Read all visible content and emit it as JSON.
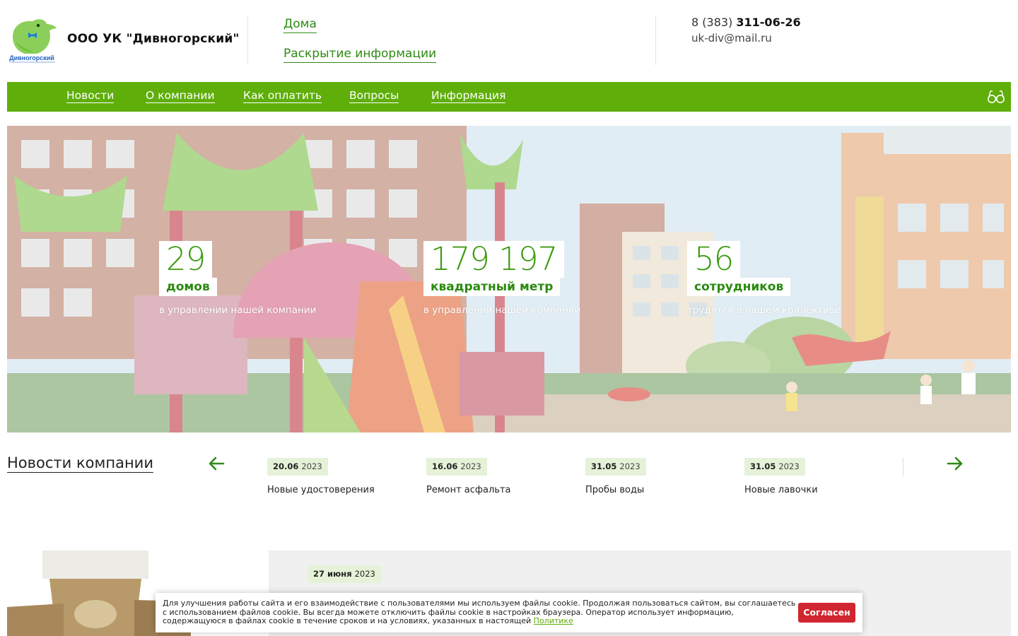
{
  "header": {
    "company_name": "ООО УК \"Дивногорский\"",
    "logo_text": "Дивногорский",
    "links": [
      "Дома",
      "Раскрытие информации"
    ],
    "phone_prefix": "8 (383)",
    "phone_number": "311-06-26",
    "email": "uk-div@mail.ru"
  },
  "nav": {
    "items": [
      "Новости",
      "О компании",
      "Как оплатить",
      "Вопросы",
      "Информация"
    ],
    "accessibility_icon": "glasses-icon"
  },
  "stats": [
    {
      "value": "29",
      "unit": "домов",
      "desc": "в управлении нашей компании"
    },
    {
      "value": "179 197",
      "unit": "квадратный метр",
      "desc": "в управлении нашей компании"
    },
    {
      "value": "56",
      "unit": "сотрудников",
      "desc": "трудятся в нашем коллективе"
    }
  ],
  "news": {
    "title": "Новости компании",
    "items": [
      {
        "day": "20.06",
        "year": "2023",
        "title": "Новые удостоверения"
      },
      {
        "day": "16.06",
        "year": "2023",
        "title": "Ремонт асфальта"
      },
      {
        "day": "31.05",
        "year": "2023",
        "title": "Пробы воды"
      },
      {
        "day": "31.05",
        "year": "2023",
        "title": "Новые лавочки"
      }
    ]
  },
  "article": {
    "day": "27 июня",
    "year": "2023"
  },
  "cookie": {
    "text": "Для улучшения работы сайта и его взаимодействие с пользователями мы используем файлы cookie. Продолжая пользоваться сайтом, вы соглашаетесь с использованием файлов cookie. Вы всегда можете отключить файлы cookie в настройках браузера. Оператор использует информацию, содержащуюся в файлах cookie в течение сроков и на условиях, указанных в настоящей",
    "link": "Политике",
    "button": "Согласен"
  },
  "colors": {
    "brand_green": "#5fae0a",
    "text_green": "#2f8a15",
    "date_bg": "#e6f2d8",
    "cookie_button": "#d0262f"
  }
}
